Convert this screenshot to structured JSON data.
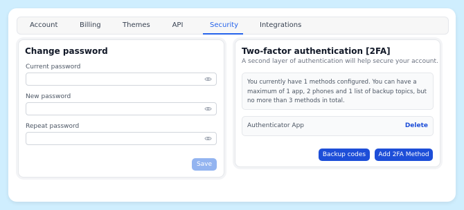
{
  "tabs": [
    {
      "label": "Account"
    },
    {
      "label": "Billing"
    },
    {
      "label": "Themes"
    },
    {
      "label": "API"
    },
    {
      "label": "Security",
      "active": true
    },
    {
      "label": "Integrations"
    }
  ],
  "change_password": {
    "title": "Change password",
    "fields": [
      {
        "label": "Current password",
        "value": "",
        "icon": "eye-icon"
      },
      {
        "label": "New password",
        "value": "",
        "icon": "eye-icon"
      },
      {
        "label": "Repeat password",
        "value": "",
        "icon": "eye-icon"
      }
    ],
    "save_label": "Save"
  },
  "two_factor": {
    "title": "Two-factor authentication [2FA]",
    "subtitle": "A second layer of authentication will help secure your account.",
    "info": "You currently have 1 methods configured. You can have a maximum of 1 app, 2 phones and 1 list of backup topics, but no more than 3 methods in total.",
    "methods": [
      {
        "name": "Authenticator App",
        "action": "Delete"
      }
    ],
    "backup_codes_label": "Backup codes",
    "add_method_label": "Add 2FA Method"
  },
  "colors": {
    "accent": "#1d4ed8",
    "tab_active": "#2563eb",
    "save_disabled": "#93b4f0",
    "page_background": "#cfeefe"
  }
}
